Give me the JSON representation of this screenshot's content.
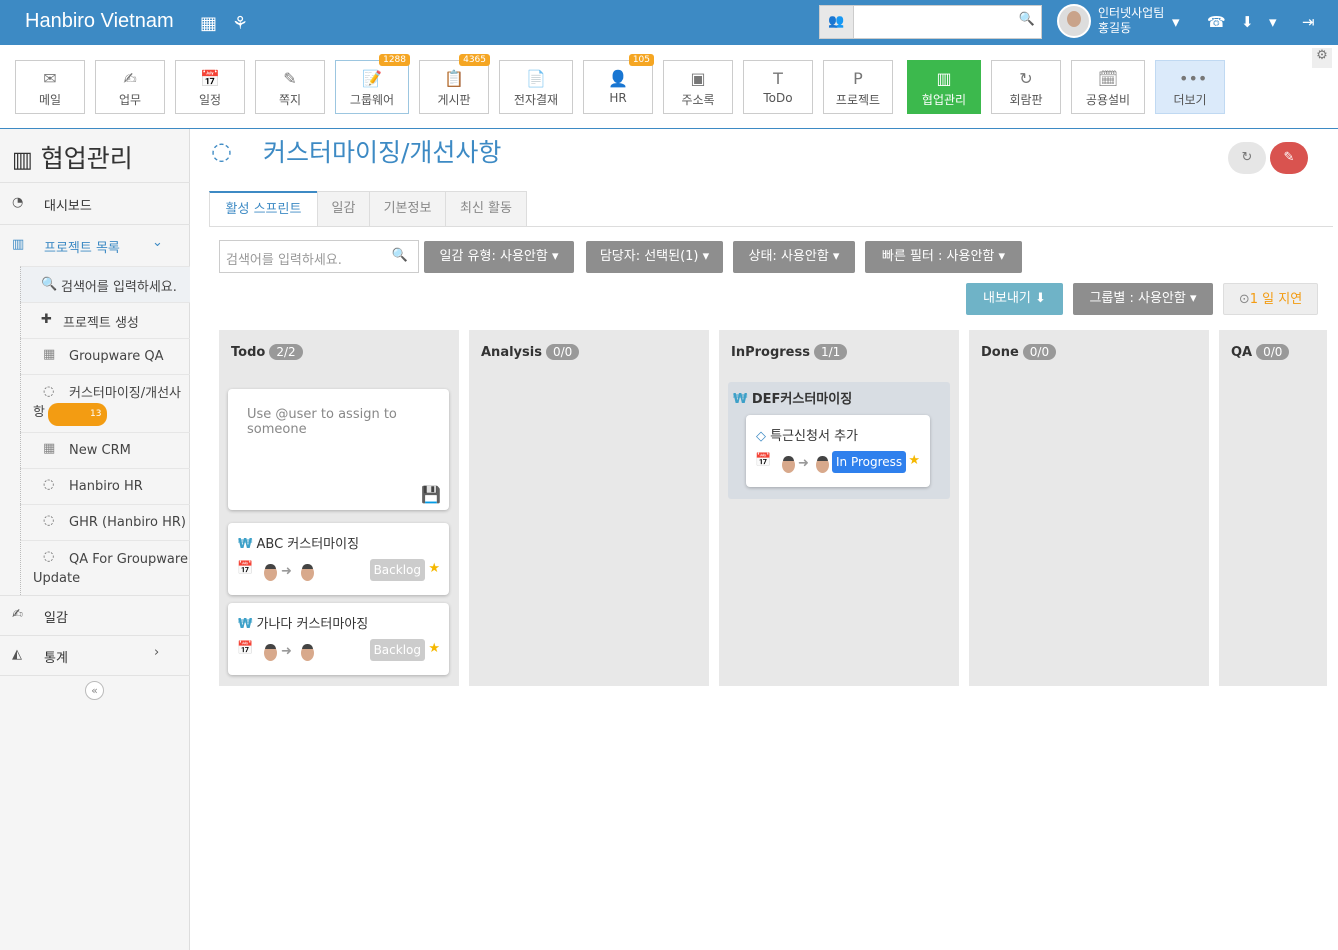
{
  "brand": "Hanbiro Vietnam",
  "user": {
    "team": "인터넷사업팀",
    "name": "홍길동"
  },
  "apps": [
    {
      "label": "메일",
      "badge": ""
    },
    {
      "label": "업무",
      "badge": ""
    },
    {
      "label": "일정",
      "badge": ""
    },
    {
      "label": "쪽지",
      "badge": ""
    },
    {
      "label": "그룹웨어",
      "badge": "1288"
    },
    {
      "label": "게시판",
      "badge": "4365"
    },
    {
      "label": "전자결재",
      "badge": ""
    },
    {
      "label": "HR",
      "badge": "105"
    },
    {
      "label": "주소록",
      "badge": ""
    },
    {
      "label": "ToDo",
      "badge": ""
    },
    {
      "label": "프로젝트",
      "badge": ""
    },
    {
      "label": "협업관리",
      "badge": ""
    },
    {
      "label": "회람판",
      "badge": ""
    },
    {
      "label": "공용설비",
      "badge": ""
    },
    {
      "label": "더보기",
      "badge": ""
    }
  ],
  "sidebar": {
    "title": "협업관리",
    "dashboard": "대시보드",
    "project_list": "프로젝트 목록",
    "search_placeholder": "검색어를 입력하세요.",
    "create_project": "프로젝트 생성",
    "projects": [
      {
        "label": "Groupware QA"
      },
      {
        "label": "커스터마이징/개선사항",
        "badge": "13"
      },
      {
        "label": "New CRM"
      },
      {
        "label": "Hanbiro HR"
      },
      {
        "label": "GHR (Hanbiro HR)"
      },
      {
        "label": "QA For Groupware Update"
      }
    ],
    "worklog": "일감",
    "stats": "통계"
  },
  "page": {
    "title": "커스터마이징/개선사항",
    "tabs": [
      "활성 스프린트",
      "일감",
      "기본정보",
      "최신 활동"
    ],
    "search_placeholder": "검색어를 입력하세요.",
    "filters": [
      "일감 유형: 사용안함",
      "담당자: 선택된(1)",
      "상태: 사용안함",
      "빠른 필터 : 사용안함"
    ],
    "export": "내보내기",
    "group_by": "그룹별 : 사용안함",
    "delay": "1 일 지연"
  },
  "columns": [
    {
      "name": "Todo",
      "count": "2/2"
    },
    {
      "name": "Analysis",
      "count": "0/0"
    },
    {
      "name": "InProgress",
      "count": "1/1"
    },
    {
      "name": "Done",
      "count": "0/0"
    },
    {
      "name": "QA",
      "count": "0/0"
    }
  ],
  "todo": {
    "new_placeholder": "Use @user to assign to someone",
    "cards": [
      {
        "title": "ABC 커스터마이징",
        "status": "Backlog"
      },
      {
        "title": "가나다 커스터마아징",
        "status": "Backlog"
      }
    ]
  },
  "inprogress": {
    "group": "DEF커스터마이징",
    "card": {
      "title": "특근신청서 추가",
      "status": "In Progress"
    }
  },
  "colors": {
    "primary": "#3d8ac4",
    "active_app": "#3cb94d",
    "badge": "#f5a623",
    "edit": "#d9534f",
    "export": "#6fb3c7"
  }
}
